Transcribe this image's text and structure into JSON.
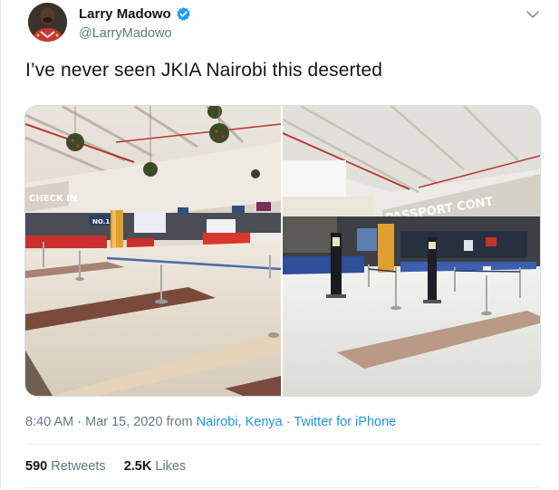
{
  "user": {
    "display_name": "Larry Madowo",
    "handle": "@LarryMadowo",
    "verified": true
  },
  "tweet": {
    "text": "I’ve never seen JKIA Nairobi this deserted"
  },
  "media": {
    "photos": [
      {
        "sign_text": "CHECK IN",
        "counter_sign": "NO.1"
      },
      {
        "sign_text": "PASSPORT CONT"
      }
    ]
  },
  "meta": {
    "time": "8:40 AM",
    "dot1": "·",
    "date": "Mar 15, 2020",
    "from_word": "from",
    "location": "Nairobi, Kenya",
    "dot2": "·",
    "source": "Twitter for iPhone"
  },
  "stats": {
    "retweets_count": "590",
    "retweets_label": "Retweets",
    "likes_count": "2.5K",
    "likes_label": "Likes"
  },
  "colors": {
    "link": "#1b95e0",
    "muted": "#657786",
    "verified": "#1da1f2",
    "text": "#14171a"
  },
  "icons": [
    "verified-badge-icon",
    "chevron-down-icon"
  ]
}
